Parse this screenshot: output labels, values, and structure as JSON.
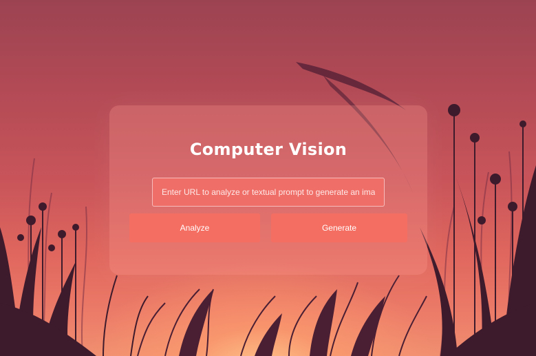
{
  "app": {
    "title": "Computer Vision"
  },
  "input": {
    "placeholder": "Enter URL to analyze or textual prompt to generate an image",
    "value": ""
  },
  "buttons": {
    "analyze_label": "Analyze",
    "generate_label": "Generate"
  },
  "colors": {
    "button_background": "#f56e62",
    "input_background": "#f06e68",
    "card_overlay": "rgba(255,160,150,0.28)",
    "text": "#ffffff"
  },
  "background": {
    "image": "sunset-meadow-silhouette"
  }
}
